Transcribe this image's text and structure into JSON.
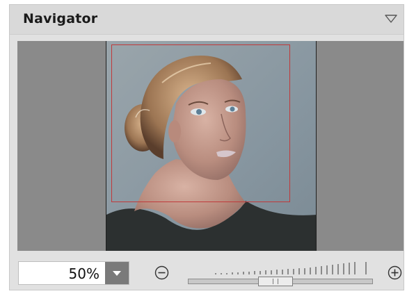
{
  "panel": {
    "title": "Navigator",
    "collapse_icon": "triangle-down-icon"
  },
  "preview": {
    "image": "portrait-of-woman-with-hair-bun",
    "frame_color": "#c0393a"
  },
  "zoom": {
    "value": "50%",
    "dropdown_icon": "caret-down-icon",
    "zoom_out_icon": "circle-minus-icon",
    "zoom_in_icon": "circle-plus-icon",
    "slider_level": 0.38
  },
  "colors": {
    "panel_bg": "#e1e1e1",
    "viewport_bg": "#8a8a8a",
    "dropdown_bg": "#7a7a7a"
  }
}
